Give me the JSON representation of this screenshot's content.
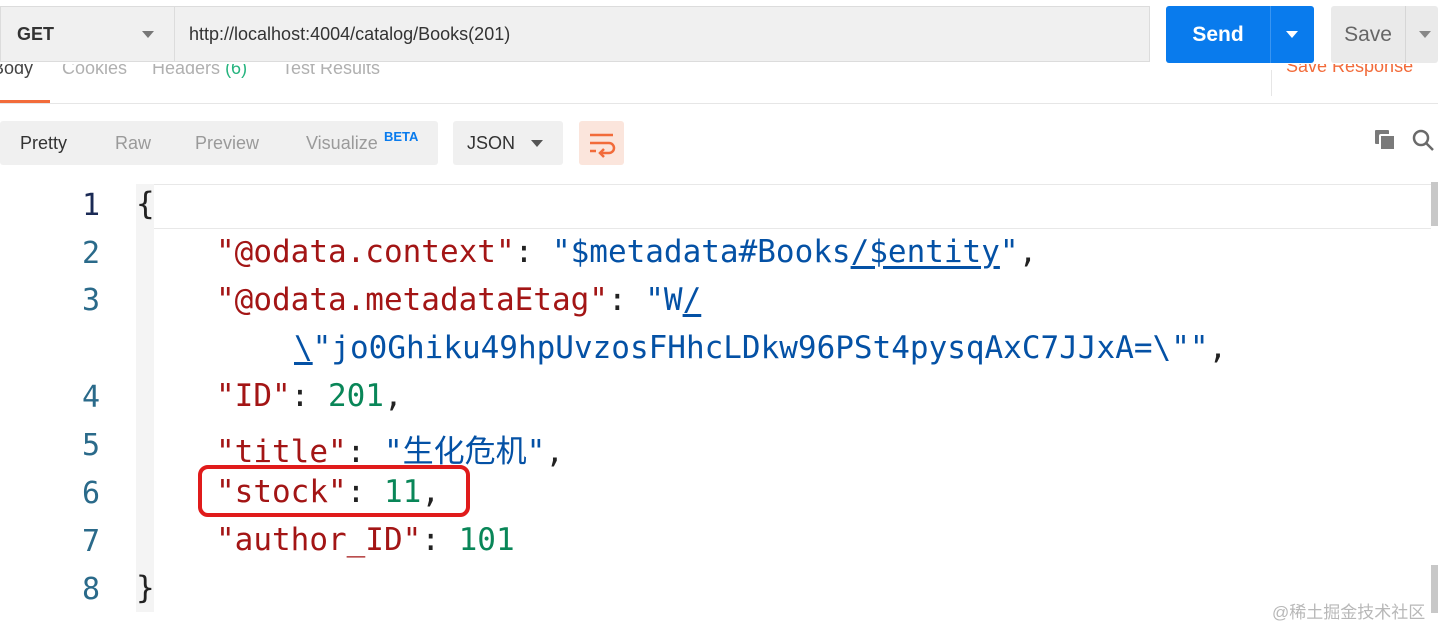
{
  "request": {
    "method": "GET",
    "url": "http://localhost:4004/catalog/Books(201)",
    "send_label": "Send",
    "save_label": "Save"
  },
  "response_tabs": {
    "items": [
      {
        "label": "Body"
      },
      {
        "label": "Cookies"
      },
      {
        "label": "Headers",
        "count": "(6)"
      },
      {
        "label": "Test Results"
      }
    ],
    "save_response": "Save Response"
  },
  "view": {
    "modes": [
      "Pretty",
      "Raw",
      "Preview",
      "Visualize"
    ],
    "beta_badge": "BETA",
    "format": "JSON"
  },
  "editor": {
    "line_numbers": [
      "1",
      "2",
      "3",
      "4",
      "5",
      "6",
      "7",
      "8"
    ],
    "lines": {
      "l1": "{",
      "l2_key": "\"@odata.context\"",
      "l2_val_a": "\"$metadata#Books",
      "l2_val_b": "/$entity",
      "l2_val_c": "\"",
      "l3_key": "\"@odata.metadataEtag\"",
      "l3_val_a": "\"W",
      "l3_val_b": "/",
      "l4_cont_a": "\\",
      "l4_cont_b": "\"jo0Ghiku49hpUvzosFHhcLDkw96PSt4pysqAxC7JJxA=\\\"\"",
      "l5_key": "\"ID\"",
      "l5_val": "201",
      "l6_key": "\"title\"",
      "l6_val": "\"生化危机\"",
      "l7_key": "\"stock\"",
      "l7_val": "11",
      "l8_key": "\"author_ID\"",
      "l8_val": "101",
      "l9": "}"
    }
  },
  "watermark": "@稀土掘金技术社区",
  "colors": {
    "send": "#097bed",
    "accent": "#f26b3a",
    "highlight": "#e01b1b"
  }
}
